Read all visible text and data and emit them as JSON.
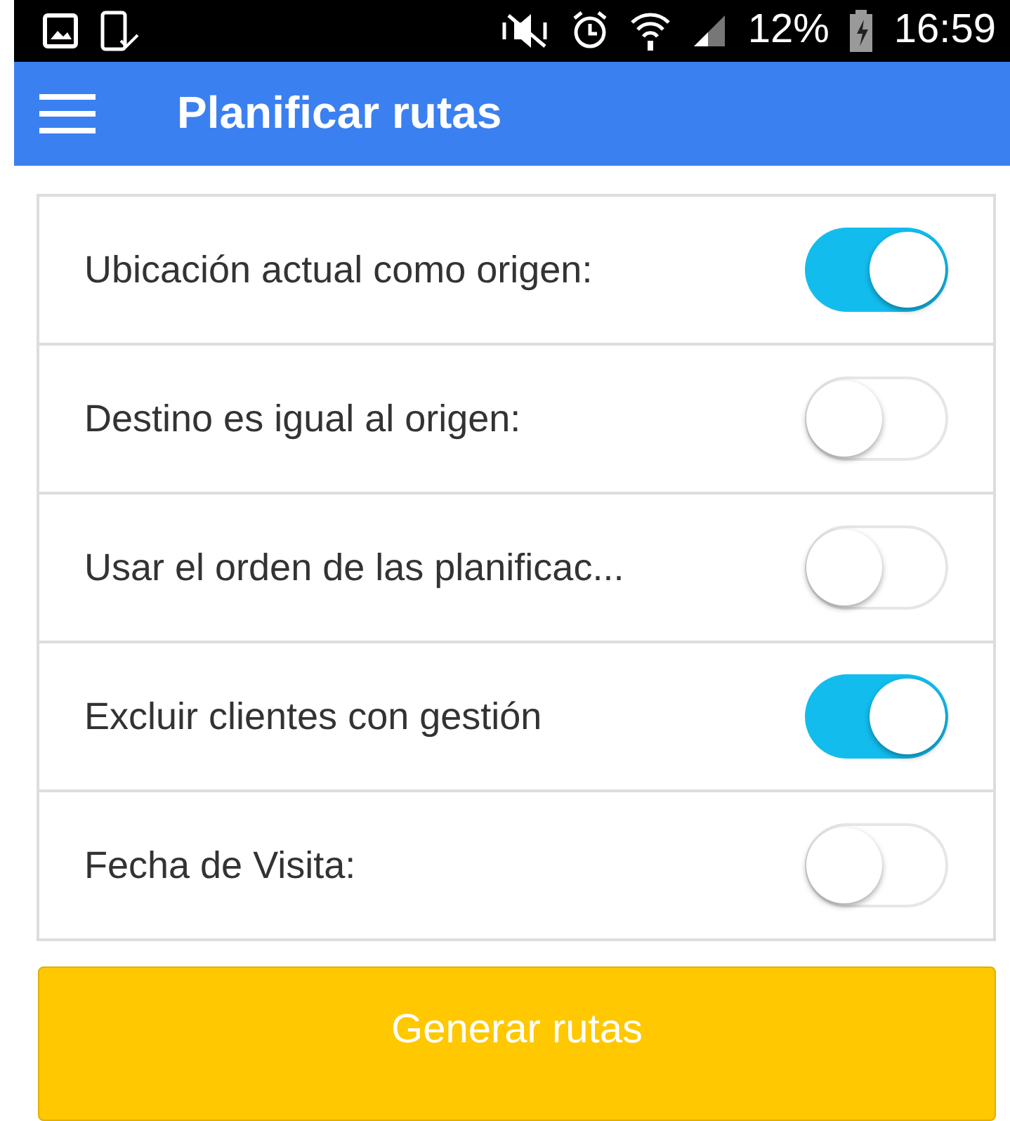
{
  "status_bar": {
    "battery": "12%",
    "time": "16:59"
  },
  "header": {
    "title": "Planificar rutas"
  },
  "settings": [
    {
      "label": "Ubicación actual como origen:",
      "on": true
    },
    {
      "label": "Destino es igual al origen:",
      "on": false
    },
    {
      "label": "Usar el orden de las planificac...",
      "on": false
    },
    {
      "label": "Excluir clientes con gestión",
      "on": true
    },
    {
      "label": "Fecha de Visita:",
      "on": false
    }
  ],
  "button": "Generar rutas"
}
